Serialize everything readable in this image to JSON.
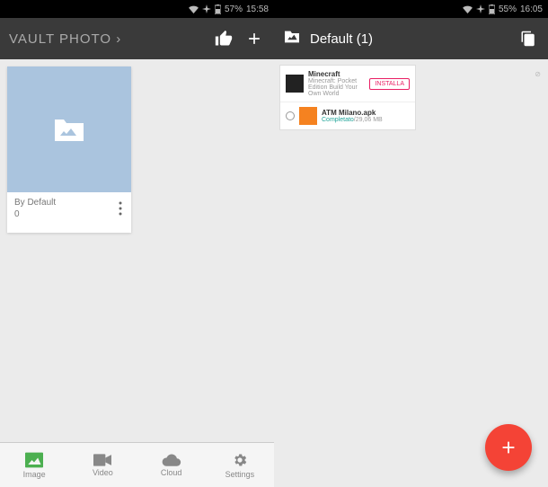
{
  "left": {
    "status": {
      "battery": "57%",
      "time": "15:58"
    },
    "appbar": {
      "title": "VAULT PHOTO ›"
    },
    "album": {
      "name": "By Default",
      "count": "0"
    },
    "nav": {
      "image": "Image",
      "video": "Video",
      "cloud": "Cloud",
      "settings": "Settings"
    }
  },
  "right": {
    "status": {
      "battery": "55%",
      "time": "16:05"
    },
    "appbar": {
      "folder": "Default (1)"
    },
    "downloads": {
      "item1": {
        "title": "Minecraft",
        "sub": "Minecraft: Pocket Edition Build Your Own World",
        "action": "INSTALLA"
      },
      "item2": {
        "title": "ATM Milano.apk",
        "status": "Completato",
        "size": "29,06 MB"
      }
    }
  }
}
